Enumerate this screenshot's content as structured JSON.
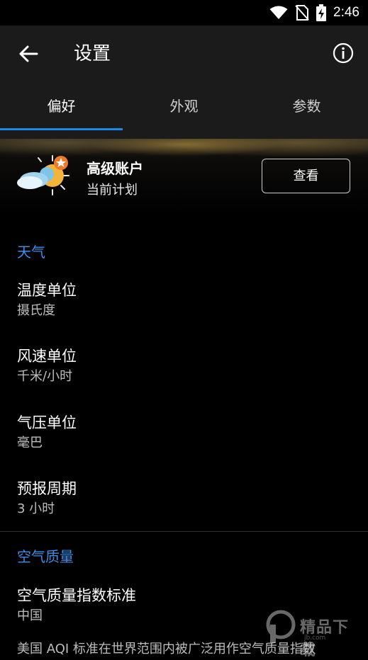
{
  "status": {
    "time": "2:46"
  },
  "appbar": {
    "title": "设置"
  },
  "tabs": [
    {
      "label": "偏好"
    },
    {
      "label": "外观"
    },
    {
      "label": "参数"
    }
  ],
  "premium": {
    "title": "高级账户",
    "subtitle": "当前计划",
    "button": "查看"
  },
  "weather": {
    "header": "天气",
    "items": [
      {
        "title": "温度单位",
        "value": "摄氏度"
      },
      {
        "title": "风速单位",
        "value": "千米/小时"
      },
      {
        "title": "气压单位",
        "value": "毫巴"
      },
      {
        "title": "预报周期",
        "value": "3 小时"
      }
    ]
  },
  "air": {
    "header": "空气质量",
    "items": [
      {
        "title": "空气质量指数标准",
        "value": "中国"
      }
    ],
    "description": "美国 AQI 标准在世界范围内被广泛用作空气质量指数"
  },
  "watermark": {
    "text": "精品下载",
    "url": "jb.com"
  },
  "colors": {
    "accent": "#1e88e5",
    "section": "#3d8eea",
    "appbar": "#1b1b1b"
  }
}
